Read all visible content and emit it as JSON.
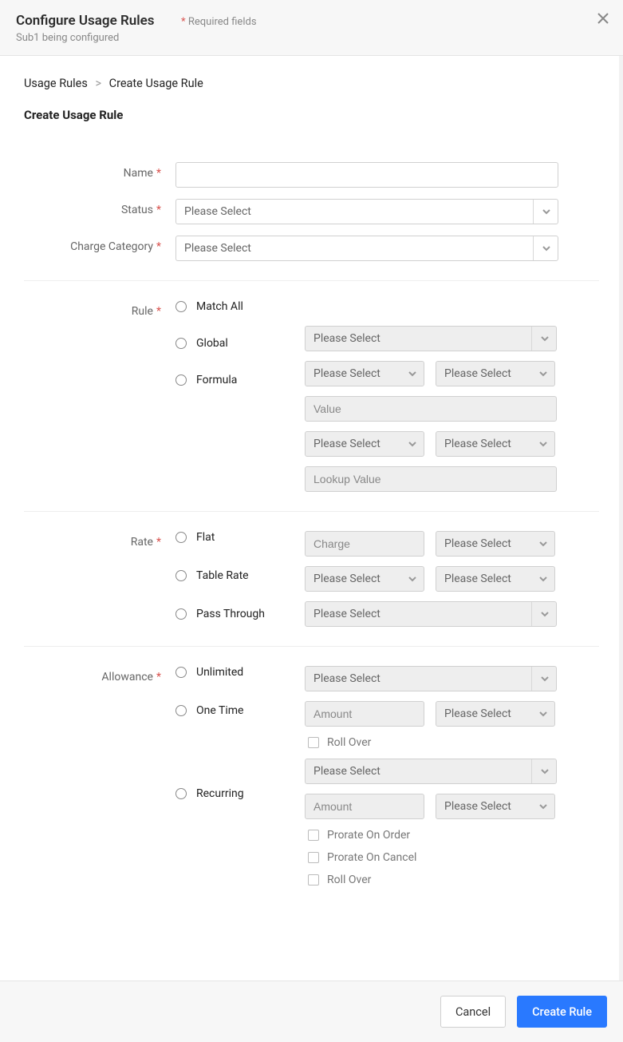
{
  "header": {
    "title": "Configure Usage Rules",
    "required_label": "Required fields",
    "subtitle": "Sub1 being configured"
  },
  "breadcrumb": {
    "root": "Usage Rules",
    "current": "Create Usage Rule"
  },
  "page_title": "Create Usage Rule",
  "labels": {
    "name": "Name",
    "status": "Status",
    "charge_category": "Charge Category",
    "rule": "Rule",
    "rate": "Rate",
    "allowance": "Allowance"
  },
  "placeholders": {
    "please_select": "Please Select",
    "value": "Value",
    "lookup_value": "Lookup Value",
    "charge": "Charge",
    "amount": "Amount"
  },
  "rule_options": {
    "match_all": "Match All",
    "global": "Global",
    "formula": "Formula"
  },
  "rate_options": {
    "flat": "Flat",
    "table_rate": "Table Rate",
    "pass_through": "Pass Through"
  },
  "allowance_options": {
    "unlimited": "Unlimited",
    "one_time": "One Time",
    "recurring": "Recurring"
  },
  "checkboxes": {
    "roll_over": "Roll Over",
    "prorate_order": "Prorate On Order",
    "prorate_cancel": "Prorate On Cancel"
  },
  "footer": {
    "cancel": "Cancel",
    "create": "Create Rule"
  }
}
